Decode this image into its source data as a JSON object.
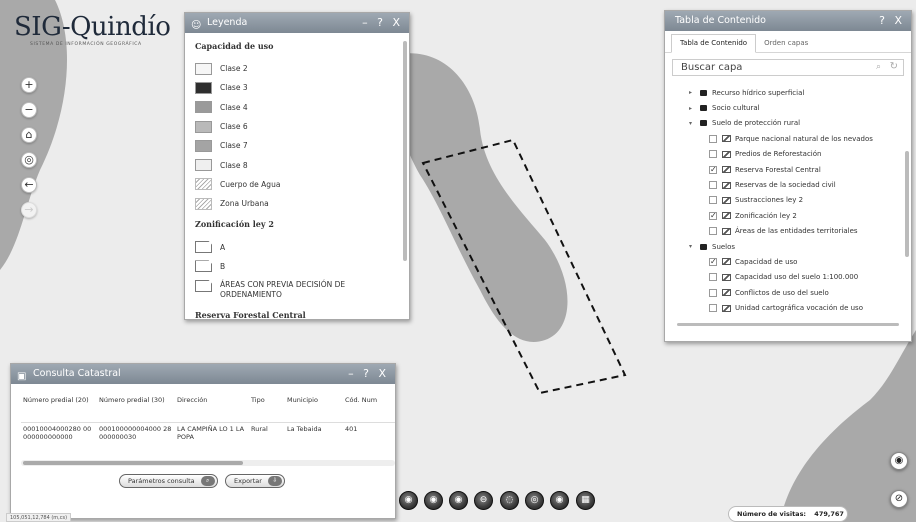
{
  "colors": {
    "map_bg": "#ececec",
    "zone_gray": "#a9a9a9",
    "header": "#8a949e"
  },
  "logo": {
    "title": "SIG-Quindío",
    "subtitle": "SISTEMA DE INFORMACIÓN GEOGRÁFICA"
  },
  "nav": [
    {
      "icon": "zoom-in-icon",
      "glyph": "+"
    },
    {
      "icon": "zoom-out-icon",
      "glyph": "−"
    },
    {
      "icon": "home-icon",
      "glyph": "⌂"
    },
    {
      "icon": "locate-icon",
      "glyph": "◎"
    },
    {
      "icon": "back-icon",
      "glyph": "←"
    },
    {
      "icon": "forward-icon",
      "glyph": "→"
    }
  ],
  "legend": {
    "title": "Leyenda",
    "controls": "– ? X",
    "section1": "Capacidad de uso",
    "items1": [
      {
        "label": "Clase 2",
        "color": "#f6f6f6"
      },
      {
        "label": "Clase 3",
        "color": "#2e2e2e"
      },
      {
        "label": "Clase 4",
        "color": "#9a9a9a"
      },
      {
        "label": "Clase 6",
        "color": "#b9b9b9"
      },
      {
        "label": "Clase 7",
        "color": "#a4a4a4"
      },
      {
        "label": "Clase 8",
        "color": "#efefef"
      },
      {
        "label": "Cuerpo de Agua",
        "color": "hatch"
      },
      {
        "label": "Zona Urbana",
        "color": "hatch"
      }
    ],
    "section2": "Zonificación ley 2",
    "items2": [
      {
        "label": "A"
      },
      {
        "label": "B"
      },
      {
        "label": "ÁREAS CON PREVIA DECISIÓN DE ORDENAMIENTO"
      }
    ],
    "section3": "Reserva Forestal Central"
  },
  "toc": {
    "title": "Tabla de Contenido",
    "controls": "? X",
    "tabs": [
      "Tabla de Contenido",
      "Orden capas"
    ],
    "search_value": "Buscar capa",
    "tree": [
      {
        "level": 0,
        "type": "folder",
        "expand": "▸",
        "label": "Recurso hídrico superficial"
      },
      {
        "level": 0,
        "type": "folder",
        "expand": "▸",
        "label": "Socio cultural"
      },
      {
        "level": 0,
        "type": "folder",
        "expand": "▾",
        "label": "Suelo de protección rural"
      },
      {
        "level": 1,
        "type": "layer",
        "checked": false,
        "label": "Parque nacional natural de los nevados"
      },
      {
        "level": 1,
        "type": "layer",
        "checked": false,
        "label": "Predios de Reforestación"
      },
      {
        "level": 1,
        "type": "layer",
        "checked": true,
        "label": "Reserva Forestal Central"
      },
      {
        "level": 1,
        "type": "layer",
        "checked": false,
        "label": "Reservas de la sociedad civil"
      },
      {
        "level": 1,
        "type": "layer",
        "checked": false,
        "label": "Sustracciones ley 2"
      },
      {
        "level": 1,
        "type": "layer",
        "checked": true,
        "label": "Zonificación ley 2"
      },
      {
        "level": 1,
        "type": "layer",
        "checked": false,
        "label": "Áreas de las entidades territoriales"
      },
      {
        "level": 0,
        "type": "folder",
        "expand": "▾",
        "label": "Suelos"
      },
      {
        "level": 1,
        "type": "layer",
        "checked": true,
        "label": "Capacidad de uso"
      },
      {
        "level": 1,
        "type": "layer",
        "checked": false,
        "label": "Capacidad uso del suelo 1:100.000"
      },
      {
        "level": 1,
        "type": "layer",
        "checked": false,
        "label": "Conflictos de uso del suelo"
      },
      {
        "level": 1,
        "type": "layer",
        "checked": false,
        "label": "Unidad cartográfica vocación de uso"
      }
    ]
  },
  "consulta": {
    "title": "Consulta Catastral",
    "controls": "– ? X",
    "columns": [
      "Número predial (20)",
      "Número predial (30)",
      "Dirección",
      "Tipo",
      "Municipio",
      "Cód. Num"
    ],
    "rows": [
      [
        "00010004000280 00000000000000",
        "000100000004000 28000000030",
        "LA CAMPIÑA LO 1 LA POPA",
        "Rural",
        "La Tebaida",
        "401"
      ]
    ],
    "btn_params": "Parámetros consulta",
    "btn_export": "Exportar"
  },
  "toolbar": [
    {
      "icon": "map-tool-icon",
      "glyph": "◉"
    },
    {
      "icon": "layers-tool-icon",
      "glyph": "◉"
    },
    {
      "icon": "draw-tool-icon",
      "glyph": "◉"
    },
    {
      "icon": "measure-tool-icon",
      "glyph": "⊖"
    },
    {
      "icon": "globe-tool-icon",
      "glyph": "◌"
    },
    {
      "icon": "query-tool-icon",
      "glyph": "◎"
    },
    {
      "icon": "print-tool-icon",
      "glyph": "◉"
    },
    {
      "icon": "table-tool-icon",
      "glyph": "▦"
    }
  ],
  "visits": {
    "label": "Número de visitas:",
    "value": "479,767"
  },
  "coords_text": "105,051,12,784 (m,cs)"
}
